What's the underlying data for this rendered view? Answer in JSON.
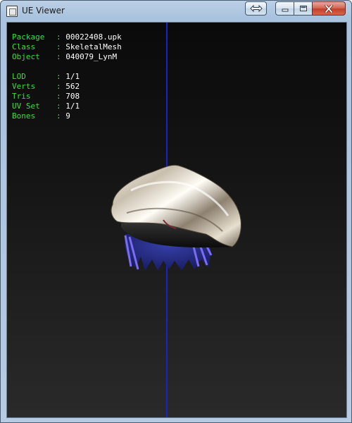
{
  "window": {
    "title": "UE Viewer",
    "icons": {
      "app": "app-window-icon",
      "restore": "restore-arrows-icon",
      "minimize": "minimize-icon",
      "maximize": "maximize-icon",
      "close": "close-icon"
    },
    "colors": {
      "titlebar": "#b7cbe2",
      "close_button": "#c2402b"
    }
  },
  "viewport": {
    "colors": {
      "background_top": "#0a0a0a",
      "background_bottom": "#2a2a2a",
      "label": "#3fdc3f",
      "value": "#ffffff",
      "axis": "#1b22c8"
    },
    "info_group_1": [
      {
        "label": "Package",
        "value": "00022408.upk"
      },
      {
        "label": "Class",
        "value": "SkeletalMesh"
      },
      {
        "label": "Object",
        "value": "040079_LynM"
      }
    ],
    "info_group_2": [
      {
        "label": "LOD",
        "value": "1/1"
      },
      {
        "label": "Verts",
        "value": "562"
      },
      {
        "label": "Tris",
        "value": "708"
      },
      {
        "label": "UV Set",
        "value": "1/1"
      },
      {
        "label": "Bones",
        "value": "9"
      }
    ],
    "separator": ":"
  }
}
